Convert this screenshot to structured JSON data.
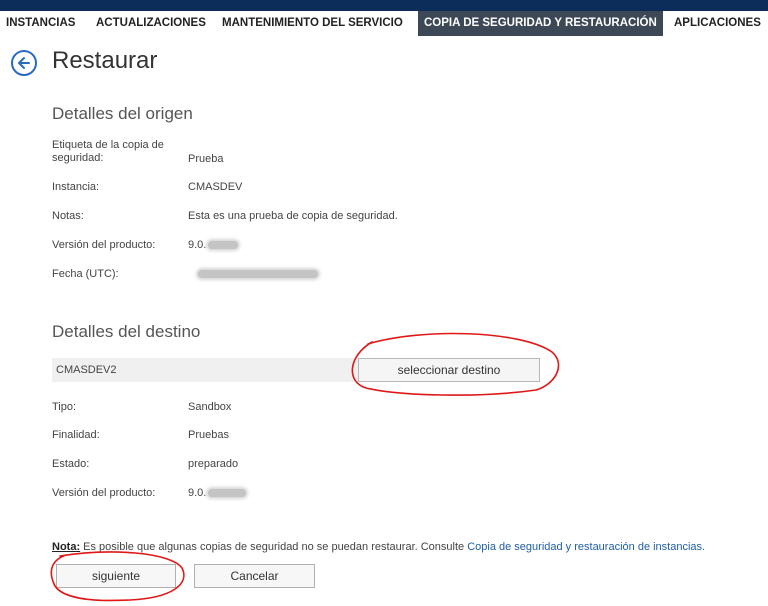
{
  "nav": {
    "items": [
      {
        "label": "INSTANCIAS",
        "active": false
      },
      {
        "label": "ACTUALIZACIONES",
        "active": false
      },
      {
        "label": "MANTENIMIENTO DEL SERVICIO",
        "active": false
      },
      {
        "label": "COPIA DE SEGURIDAD Y RESTAURACIÓN",
        "active": true
      },
      {
        "label": "APLICACIONES",
        "active": false
      }
    ]
  },
  "page": {
    "title": "Restaurar",
    "back_icon": "back-arrow-circle-icon"
  },
  "source": {
    "title": "Detalles del origen",
    "backup_label_label": "Etiqueta de la copia de seguridad:",
    "backup_label_value": "Prueba",
    "instance_label": "Instancia:",
    "instance_value": "CMASDEV",
    "notes_label": "Notas:",
    "notes_value": "Esta es una prueba de copia de seguridad.",
    "version_label": "Versión del producto:",
    "version_value": "9.0.",
    "date_label": "Fecha (UTC):"
  },
  "destination": {
    "title": "Detalles del destino",
    "selected_instance": "CMASDEV2",
    "select_button": "seleccionar destino",
    "type_label": "Tipo:",
    "type_value": "Sandbox",
    "purpose_label": "Finalidad:",
    "purpose_value": "Pruebas",
    "status_label": "Estado:",
    "status_value": "preparado",
    "version_label": "Versión del producto:",
    "version_value": "9.0."
  },
  "note": {
    "prefix": "Nota:",
    "text": " Es posible que algunas copias de seguridad no se puedan restaurar. Consulte ",
    "link": "Copia de seguridad y restauración de instancias."
  },
  "actions": {
    "next": "siguiente",
    "cancel": "Cancelar"
  },
  "colors": {
    "accent_blue": "#2b6bbf",
    "nav_active_bg": "#3c4855",
    "topbar": "#0c2d5a",
    "annotation_red": "#e01818",
    "link": "#1f5fa6"
  }
}
